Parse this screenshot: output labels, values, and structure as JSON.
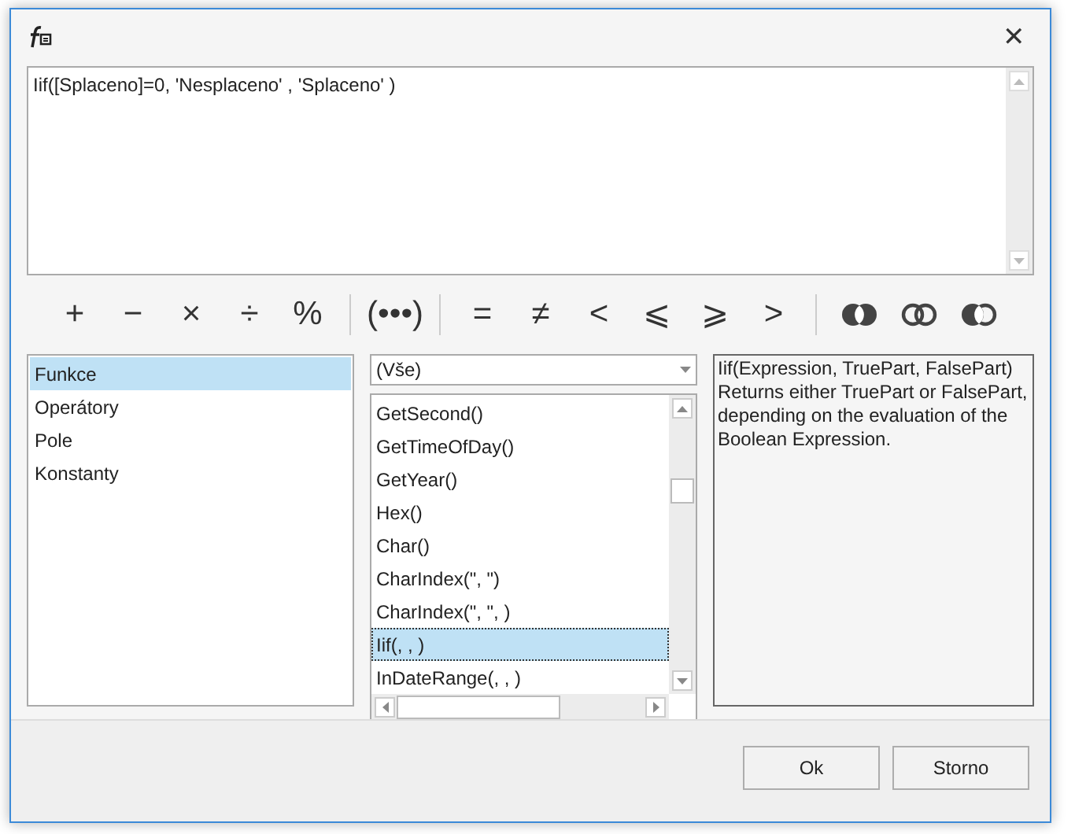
{
  "dialog": {
    "close_glyph": "✕"
  },
  "expression": {
    "value": "Iif([Splaceno]=0, 'Nesplaceno' , 'Splaceno' )"
  },
  "operator_groups": [
    [
      {
        "kind": "text",
        "symbol": "+"
      },
      {
        "kind": "text",
        "symbol": "−"
      },
      {
        "kind": "text",
        "symbol": "×"
      },
      {
        "kind": "text",
        "symbol": "÷"
      },
      {
        "kind": "text",
        "symbol": "%"
      }
    ],
    [
      {
        "kind": "text",
        "symbol": "(•••)"
      }
    ],
    [
      {
        "kind": "text",
        "symbol": "="
      },
      {
        "kind": "text",
        "symbol": "≠"
      },
      {
        "kind": "text",
        "symbol": "<"
      },
      {
        "kind": "text",
        "symbol": "⩽"
      },
      {
        "kind": "text",
        "symbol": "⩾"
      },
      {
        "kind": "text",
        "symbol": ">"
      }
    ],
    [
      {
        "kind": "and"
      },
      {
        "kind": "or"
      },
      {
        "kind": "xor"
      }
    ]
  ],
  "categories": [
    {
      "label": "Funkce",
      "selected": true
    },
    {
      "label": "Operátory",
      "selected": false
    },
    {
      "label": "Pole",
      "selected": false
    },
    {
      "label": "Konstanty",
      "selected": false
    }
  ],
  "filter": {
    "value": "(Vše)"
  },
  "functions": [
    {
      "label": "GetSecond()",
      "selected": false
    },
    {
      "label": "GetTimeOfDay()",
      "selected": false
    },
    {
      "label": "GetYear()",
      "selected": false
    },
    {
      "label": "Hex()",
      "selected": false
    },
    {
      "label": "Char()",
      "selected": false
    },
    {
      "label": "CharIndex(\", \")",
      "selected": false
    },
    {
      "label": "CharIndex(\", \", )",
      "selected": false
    },
    {
      "label": "Iif(, , )",
      "selected": true
    },
    {
      "label": "InDateRange(, , )",
      "selected": false
    }
  ],
  "description": "Iif(Expression, TruePart, FalsePart)\nReturns either TruePart or FalsePart, depending on the evaluation of the Boolean Expression.",
  "buttons": [
    "Ok",
    "Storno"
  ]
}
